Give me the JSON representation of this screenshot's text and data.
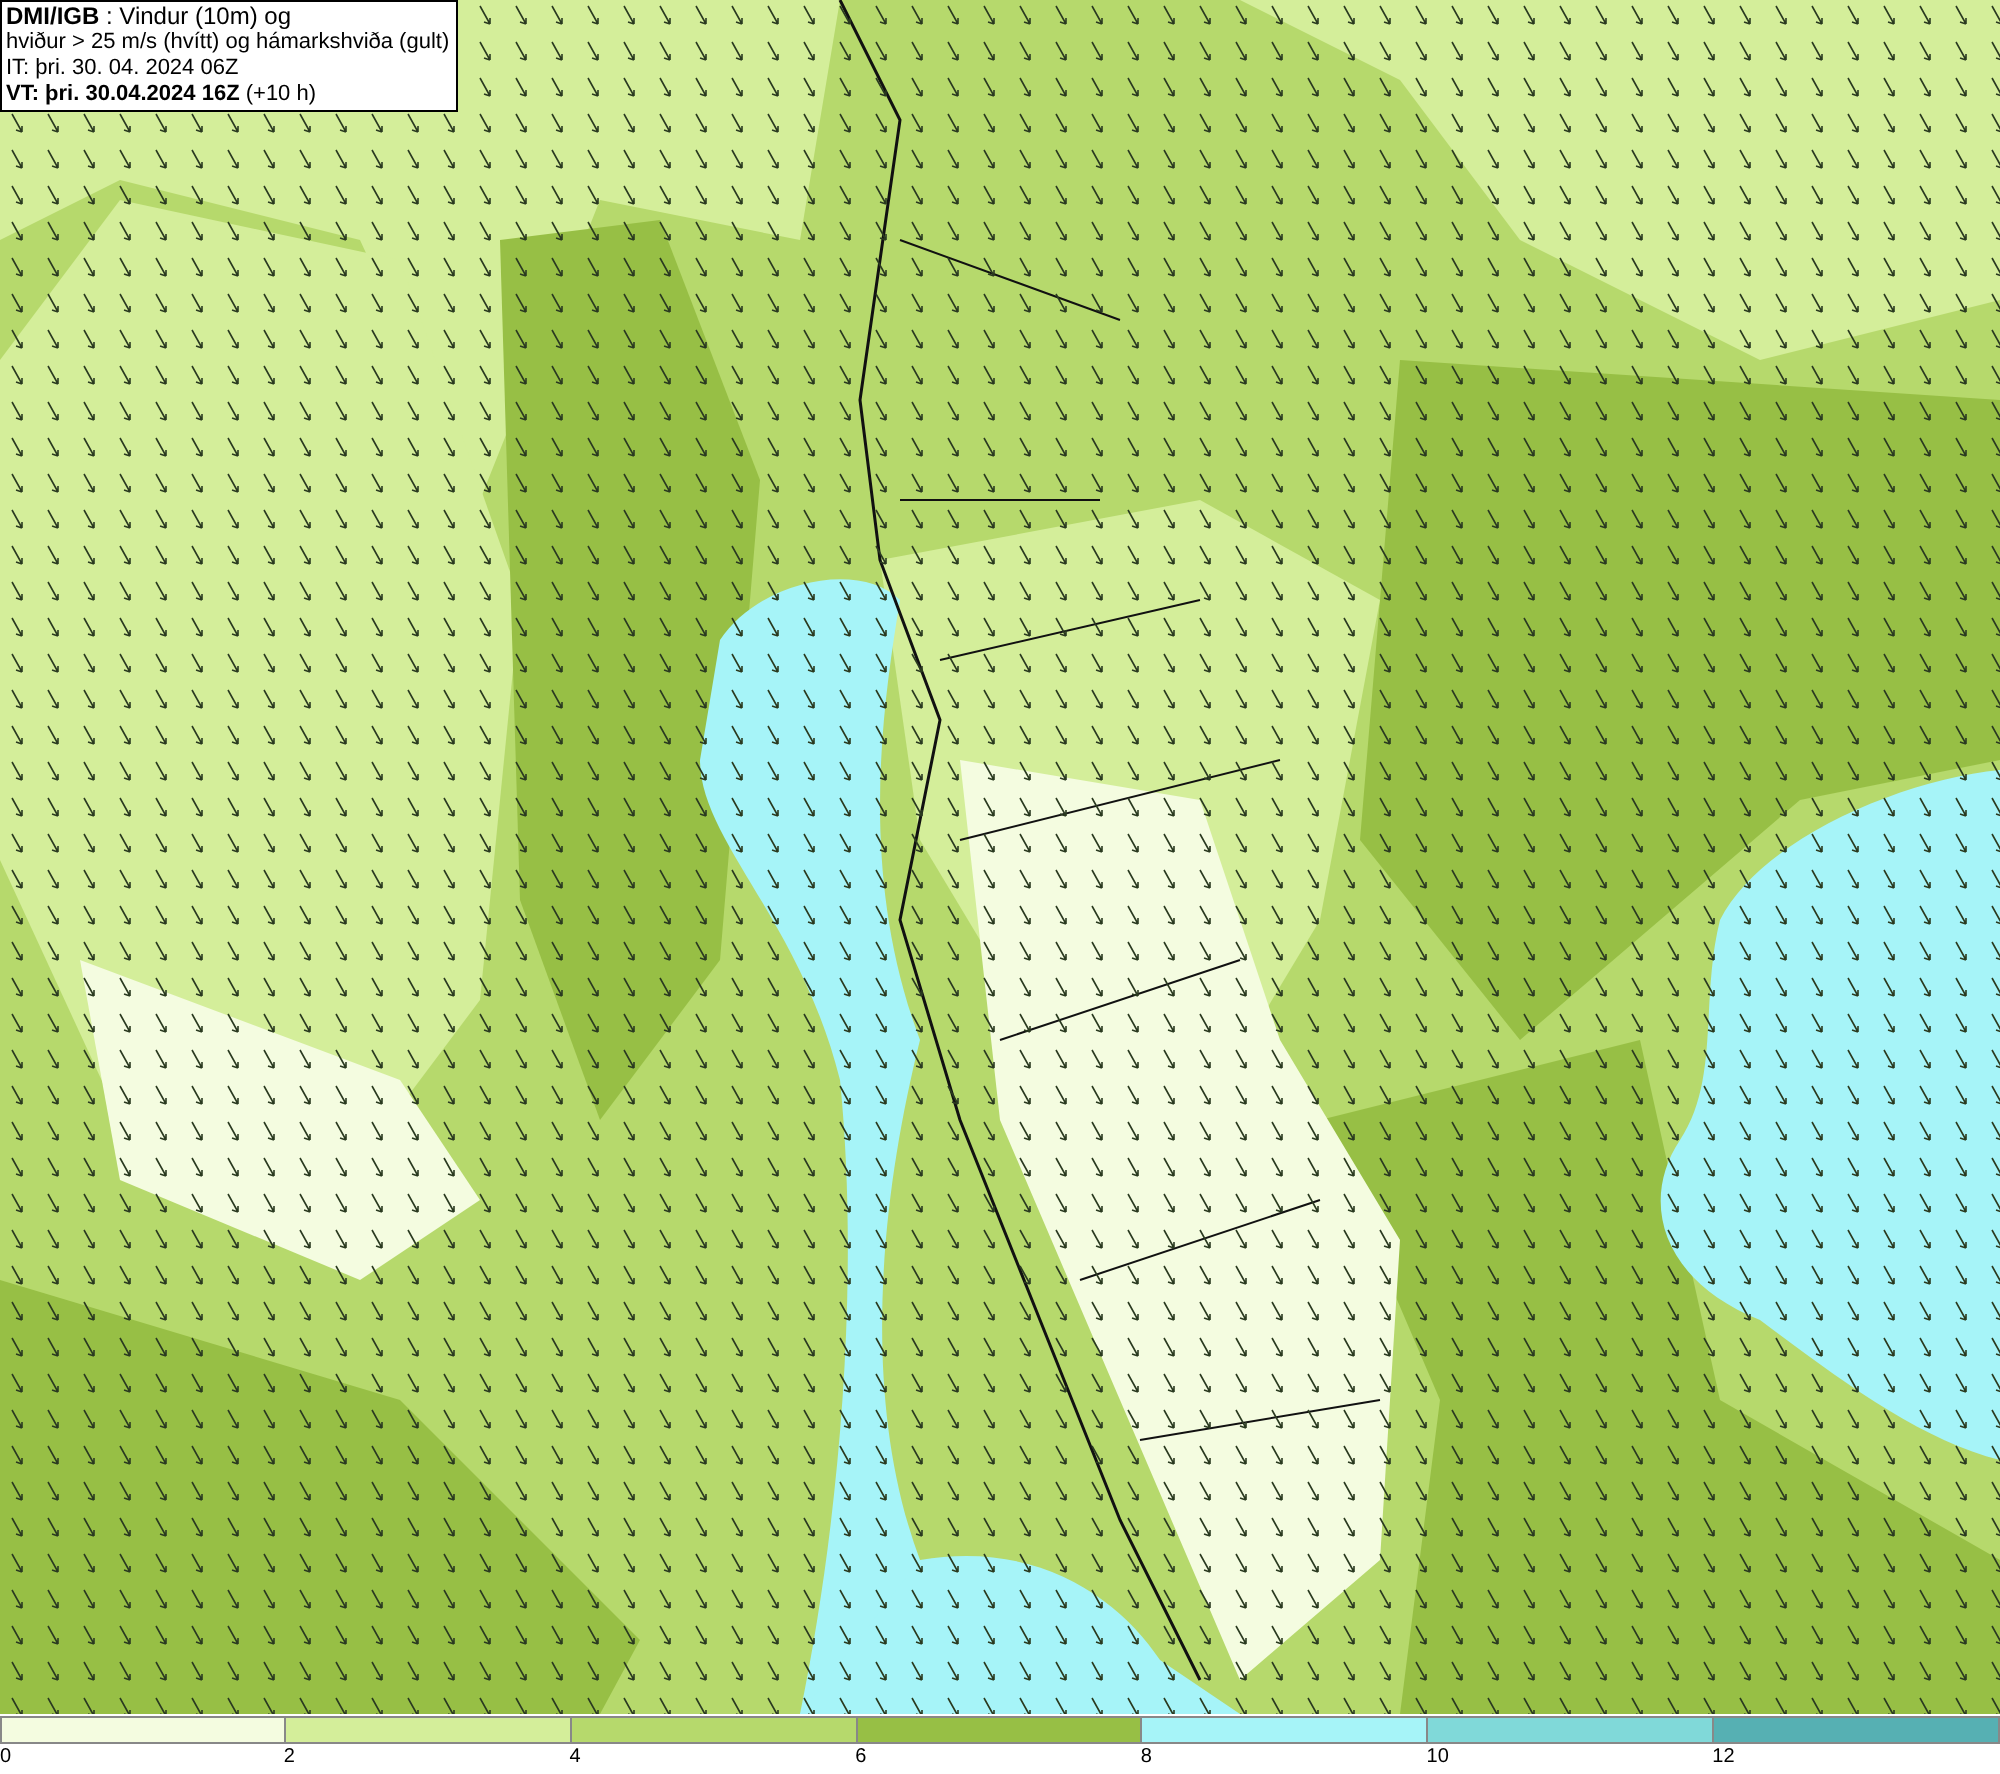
{
  "title_box": {
    "lines": [
      "**DMI/IGB** : Vindur (10m) og",
      "hviður > 25 m/s (hvítt) og hámarkshviða (gult)",
      "IT: þri. 30. 04. 2024 06Z",
      "**VT: þri. 30.04.2024 16Z** (+10 h)"
    ]
  },
  "legend": {
    "bins": [
      {
        "color": "#f4fce0"
      },
      {
        "color": "#d4ee9a"
      },
      {
        "color": "#b6d96c"
      },
      {
        "color": "#97bf45"
      },
      {
        "color": "#a6f4f8"
      },
      {
        "color": "#80d9d9"
      },
      {
        "color": "#56b0b3"
      }
    ],
    "ticks": [
      "0",
      "2",
      "4",
      "6",
      "8",
      "10",
      "12"
    ]
  }
}
